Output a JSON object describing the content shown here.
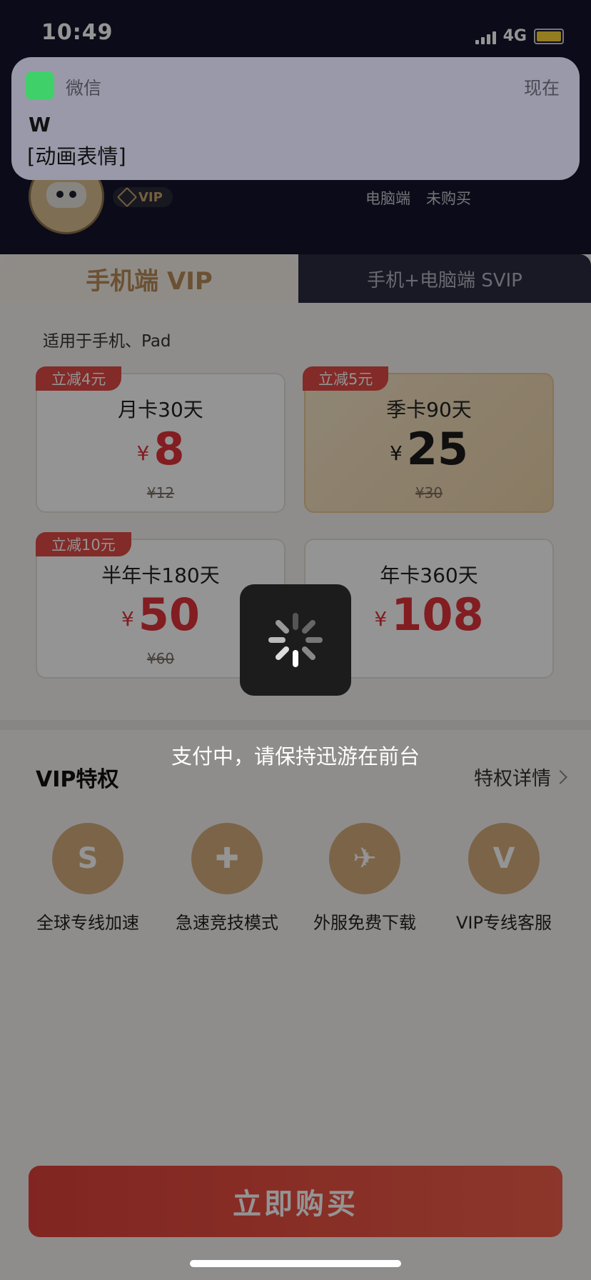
{
  "status_bar": {
    "time": "10:49",
    "network": "4G"
  },
  "notification": {
    "app_name": "微信",
    "time": "现在",
    "title": "W",
    "body": "[动画表情]"
  },
  "user": {
    "badge": "VIP",
    "info_items": [
      "电脑端",
      "未购买"
    ]
  },
  "tabs": {
    "active": "手机端 VIP",
    "inactive": "手机+电脑端 SVIP"
  },
  "applies_to": "适用于手机、Pad",
  "plans": [
    {
      "discount": "立减4元",
      "name": "月卡30天",
      "currency": "¥",
      "price": "8",
      "original": "¥12",
      "selected": false
    },
    {
      "discount": "立减5元",
      "name": "季卡90天",
      "currency": "¥",
      "price": "25",
      "original": "¥30",
      "selected": true
    },
    {
      "discount": "立减10元",
      "name": "半年卡180天",
      "currency": "¥",
      "price": "50",
      "original": "¥60",
      "selected": false
    },
    {
      "discount": "",
      "name": "年卡360天",
      "currency": "¥",
      "price": "108",
      "original": "",
      "selected": false
    }
  ],
  "privileges": {
    "title": "VIP特权",
    "link": "特权详情",
    "items": [
      {
        "label": "全球专线加速",
        "icon": "cloud-switch-icon"
      },
      {
        "label": "急速竞技模式",
        "icon": "gamepad-icon"
      },
      {
        "label": "外服免费下载",
        "icon": "airplane-icon"
      },
      {
        "label": "VIP专线客服",
        "icon": "headset-icon"
      }
    ]
  },
  "buy_button": "立即购买",
  "overlay": {
    "message": "支付中，请保持迅游在前台"
  },
  "colors": {
    "accent_red": "#e0323a",
    "gold": "#d6ad7c",
    "header_bg": "#15142b"
  }
}
